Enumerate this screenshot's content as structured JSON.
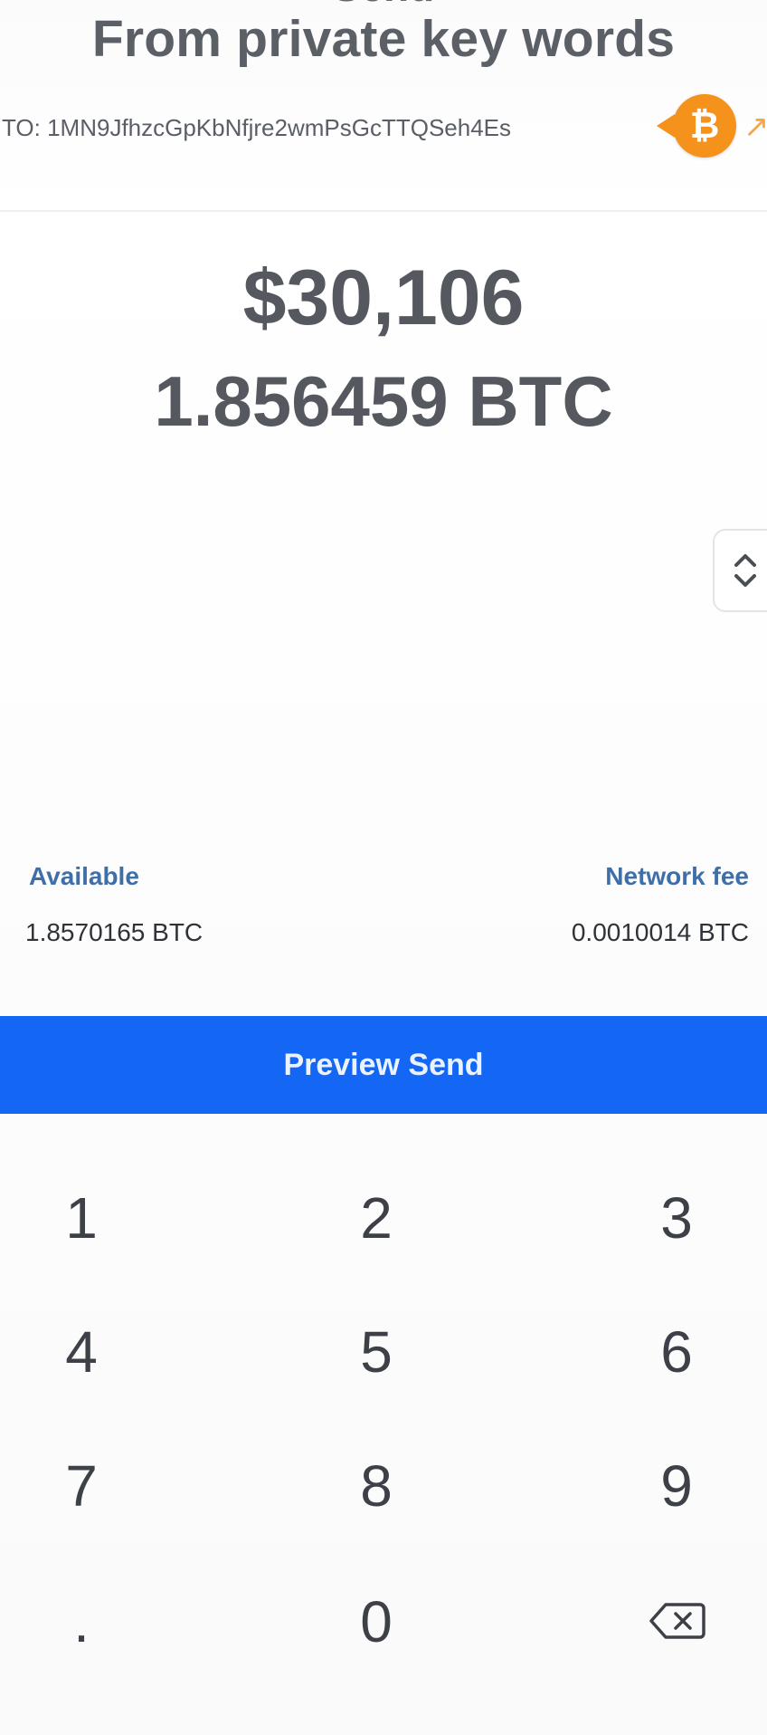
{
  "header": {
    "clipped_title": "Send",
    "subtitle": "From private key words"
  },
  "recipient": {
    "to_text": "TO: 1MN9JfhzcGpKbNfjre2wmPsGcTTQSeh4Es",
    "coin_symbol": "₿",
    "coin_color": "#f4921c"
  },
  "amount": {
    "fiat": "$30,106",
    "crypto": "1.856459 BTC"
  },
  "balances": {
    "available_label": "Available",
    "available_value": "1.8570165 BTC",
    "fee_label": "Network fee",
    "fee_value": "0.0010014 BTC"
  },
  "actions": {
    "preview_label": "Preview Send",
    "accent_color": "#1467f5"
  },
  "keypad": {
    "keys": [
      "1",
      "2",
      "3",
      "4",
      "5",
      "6",
      "7",
      "8",
      "9",
      ".",
      "0"
    ],
    "backspace_icon": "backspace-icon"
  }
}
